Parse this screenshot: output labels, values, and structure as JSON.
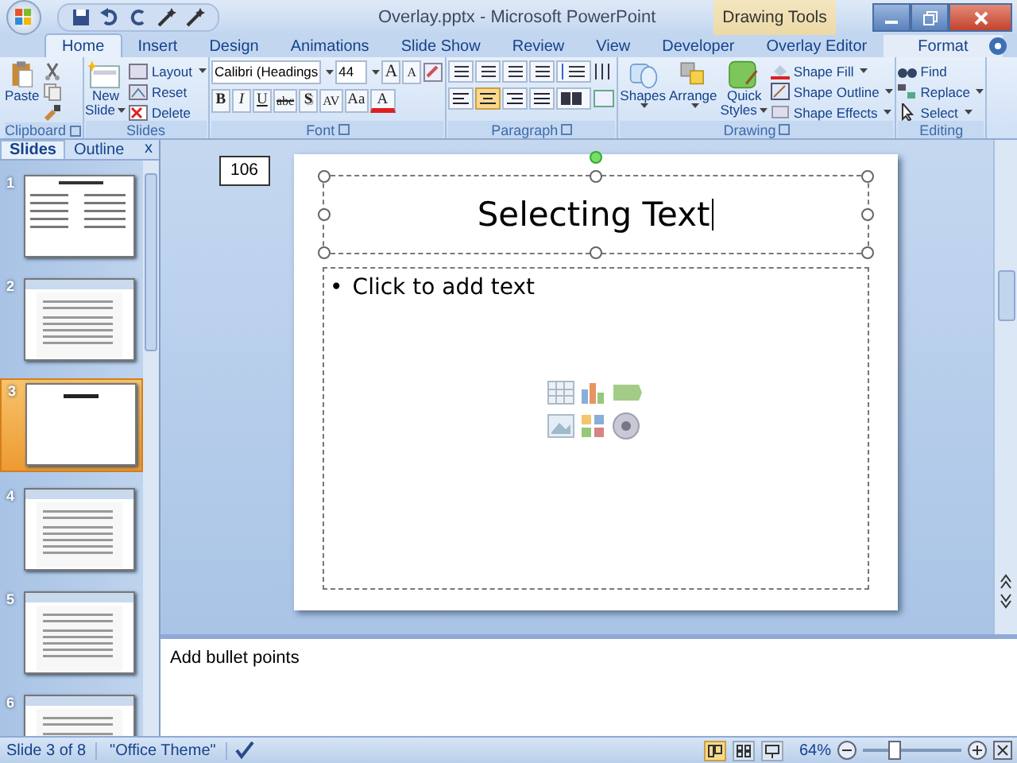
{
  "window": {
    "title": "Overlay.pptx - Microsoft PowerPoint",
    "context_label": "Drawing Tools"
  },
  "tabs": [
    {
      "label": "Home",
      "selected": true,
      "kind": "normal"
    },
    {
      "label": "Insert",
      "selected": false,
      "kind": "normal"
    },
    {
      "label": "Design",
      "selected": false,
      "kind": "normal"
    },
    {
      "label": "Animations",
      "selected": false,
      "kind": "normal"
    },
    {
      "label": "Slide Show",
      "selected": false,
      "kind": "normal"
    },
    {
      "label": "Review",
      "selected": false,
      "kind": "normal"
    },
    {
      "label": "View",
      "selected": false,
      "kind": "normal"
    },
    {
      "label": "Developer",
      "selected": false,
      "kind": "normal"
    },
    {
      "label": "Overlay Editor",
      "selected": false,
      "kind": "normal"
    },
    {
      "label": "Format",
      "selected": false,
      "kind": "contextual"
    }
  ],
  "ribbon": {
    "clipboard": {
      "label": "Clipboard",
      "paste": "Paste"
    },
    "slides": {
      "label": "Slides",
      "new_slide": [
        "New",
        "Slide"
      ],
      "layout": "Layout",
      "reset": "Reset",
      "delete": "Delete"
    },
    "font": {
      "label": "Font",
      "font_name": "Calibri (Headings",
      "font_size": "44",
      "grow": "A",
      "shrink": "A",
      "styles": [
        "B",
        "I",
        "U",
        "abc",
        "S"
      ],
      "spacing": "AV",
      "case": "Aa",
      "color_letter": "A"
    },
    "paragraph": {
      "label": "Paragraph",
      "align_buttons": [
        {
          "kind": "left",
          "selected": false
        },
        {
          "kind": "center",
          "selected": true
        },
        {
          "kind": "right",
          "selected": false
        },
        {
          "kind": "justify",
          "selected": false
        }
      ]
    },
    "drawing": {
      "label": "Drawing",
      "shapes": "Shapes",
      "arrange": "Arrange",
      "quick_styles": [
        "Quick",
        "Styles"
      ],
      "shape_fill": "Shape Fill",
      "shape_outline": "Shape Outline",
      "shape_effects": "Shape Effects"
    },
    "editing": {
      "label": "Editing",
      "find": "Find",
      "replace": "Replace",
      "select": "Select"
    }
  },
  "pane": {
    "tabs": [
      {
        "label": "Slides",
        "selected": true
      },
      {
        "label": "Outline",
        "selected": false
      }
    ],
    "close": "x",
    "slides": [
      {
        "number": "1",
        "kind": "text",
        "selected": false
      },
      {
        "number": "2",
        "kind": "screenshot",
        "selected": false
      },
      {
        "number": "3",
        "kind": "title",
        "selected": true
      },
      {
        "number": "4",
        "kind": "screenshot",
        "selected": false
      },
      {
        "number": "5",
        "kind": "screenshot",
        "selected": false
      },
      {
        "number": "6",
        "kind": "screenshot",
        "selected": false
      }
    ]
  },
  "slide": {
    "tag": "106",
    "title": "Selecting Text",
    "bullet": "•",
    "body_placeholder": "Click to add text"
  },
  "notes": {
    "text": "Add bullet points"
  },
  "status_bar": {
    "slide_info": "Slide 3 of 8",
    "theme": "\"Office Theme\"",
    "zoom": "64%",
    "zoom_slider": {
      "level": 0.3
    },
    "views": [
      {
        "kind": "normal",
        "selected": true
      },
      {
        "kind": "sorter",
        "selected": false
      },
      {
        "kind": "show",
        "selected": false
      }
    ]
  }
}
